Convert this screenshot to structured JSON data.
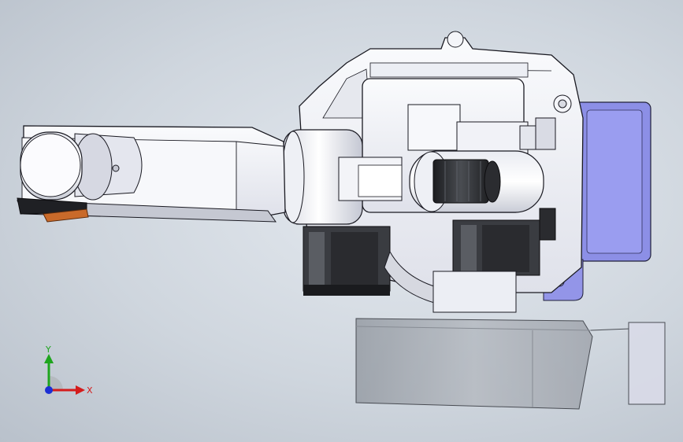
{
  "triad": {
    "x_label": "X",
    "y_label": "Y",
    "x_color": "#d41c1c",
    "y_color": "#1ea51e",
    "z_color": "#1c2fd4"
  },
  "colors": {
    "background": "#d4dae1",
    "part_white": "#f3f4f8",
    "part_shadow": "#c9ccd6",
    "edge": "#1a1a22",
    "motor_dark": "#2d2f33",
    "blue_plate": "#8e90e6",
    "gripper_orange": "#c96a2a"
  },
  "model": {
    "description_icon": "robot-arm-assembly"
  }
}
